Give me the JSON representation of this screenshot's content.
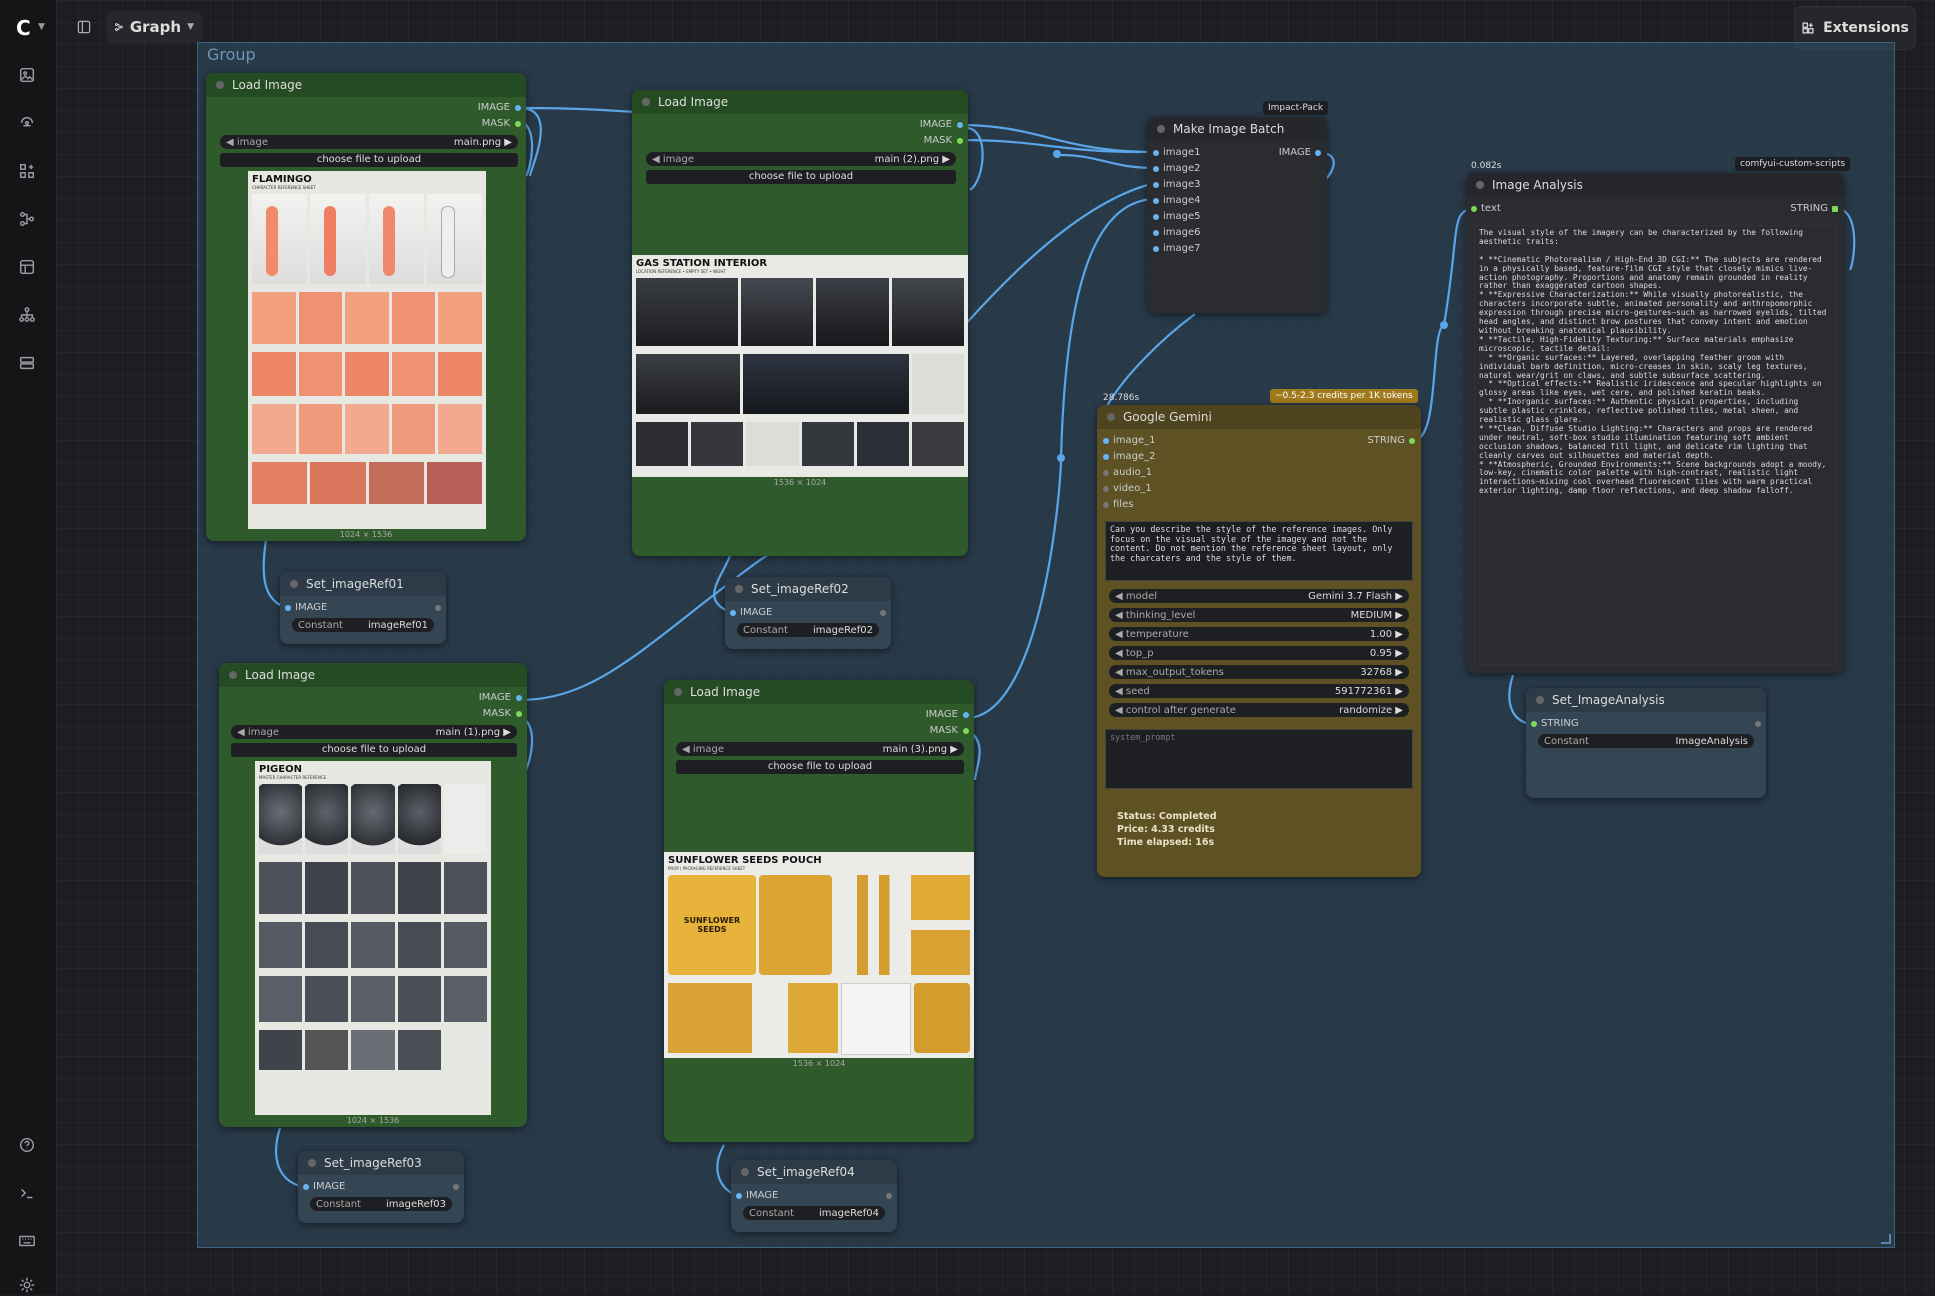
{
  "topbar": {
    "graph_label": "Graph",
    "extensions_label": "Extensions"
  },
  "group": {
    "title": "Group"
  },
  "load_image_nodes": [
    {
      "title": "Load Image",
      "out1": "IMAGE",
      "out2": "MASK",
      "widget_label": "image",
      "widget_value": "main.png",
      "upload_label": "choose file to upload",
      "img_title": "FLAMINGO",
      "img_subtitle": "CHARACTER REFERENCE SHEET",
      "caption": "1024 × 1536"
    },
    {
      "title": "Load Image",
      "out1": "IMAGE",
      "out2": "MASK",
      "widget_label": "image",
      "widget_value": "main (2).png",
      "upload_label": "choose file to upload",
      "img_title": "GAS STATION INTERIOR",
      "img_subtitle": "LOCATION REFERENCE • EMPTY SET • NIGHT",
      "caption": "1536 × 1024"
    },
    {
      "title": "Load Image",
      "out1": "IMAGE",
      "out2": "MASK",
      "widget_label": "image",
      "widget_value": "main (1).png",
      "upload_label": "choose file to upload",
      "img_title": "PIGEON",
      "img_subtitle": "MASTER CHARACTER REFERENCE",
      "caption": "1024 × 1536"
    },
    {
      "title": "Load Image",
      "out1": "IMAGE",
      "out2": "MASK",
      "widget_label": "image",
      "widget_value": "main (3).png",
      "upload_label": "choose file to upload",
      "img_title": "SUNFLOWER SEEDS POUCH",
      "img_subtitle": "PROP | PACKAGING REFERENCE SHEET",
      "caption": "1536 × 1024",
      "pouch_text": "SUNFLOWER SEEDS"
    }
  ],
  "set_nodes": [
    {
      "title": "Set_imageRef01",
      "input": "IMAGE",
      "const_label": "Constant",
      "const_value": "imageRef01"
    },
    {
      "title": "Set_imageRef02",
      "input": "IMAGE",
      "const_label": "Constant",
      "const_value": "imageRef02"
    },
    {
      "title": "Set_imageRef03",
      "input": "IMAGE",
      "const_label": "Constant",
      "const_value": "imageRef03"
    },
    {
      "title": "Set_imageRef04",
      "input": "IMAGE",
      "const_label": "Constant",
      "const_value": "imageRef04"
    },
    {
      "title": "Set_ImageAnalysis",
      "input": "STRING",
      "const_label": "Constant",
      "const_value": "ImageAnalysis"
    }
  ],
  "batch": {
    "badge": "Impact-Pack",
    "title": "Make Image Batch",
    "output": "IMAGE",
    "inputs": [
      "image1",
      "image2",
      "image3",
      "image4",
      "image5",
      "image6",
      "image7"
    ]
  },
  "gemini": {
    "time": "28.786s",
    "credits_badge": "~0.5-2.3 credits per 1K tokens",
    "title": "Google Gemini",
    "output": "STRING",
    "inputs": [
      "image_1",
      "image_2",
      "audio_1",
      "video_1",
      "files"
    ],
    "prompt": "Can you describe the style of the reference images. Only focus on the visual style of the imagey and not the content. Do not mention the reference sheet layout, only the charcaters and the style of them.",
    "widgets": [
      {
        "label": "model",
        "value": "Gemini 3.7 Flash"
      },
      {
        "label": "thinking_level",
        "value": "MEDIUM"
      },
      {
        "label": "temperature",
        "value": "1.00"
      },
      {
        "label": "top_p",
        "value": "0.95"
      },
      {
        "label": "max_output_tokens",
        "value": "32768"
      },
      {
        "label": "seed",
        "value": "591772361"
      },
      {
        "label": "control after generate",
        "value": "randomize"
      }
    ],
    "system_placeholder": "system_prompt",
    "status": "Status: Completed",
    "price": "Price: 4.33 credits",
    "elapsed": "Time elapsed: 16s"
  },
  "analysis": {
    "time": "0.082s",
    "badge": "comfyui-custom-scripts",
    "title": "Image Analysis",
    "input": "text",
    "output": "STRING",
    "text": "The visual style of the imagery can be characterized by the following aesthetic traits:\n\n* **Cinematic Photorealism / High-End 3D CGI:** The subjects are rendered in a physically based, feature-film CGI style that closely mimics live-action photography. Proportions and anatomy remain grounded in reality rather than exaggerated cartoon shapes.\n* **Expressive Characterization:** While visually photorealistic, the characters incorporate subtle, animated personality and anthropomorphic expression through precise micro-gestures—such as narrowed eyelids, tilted head angles, and distinct brow postures that convey intent and emotion without breaking anatomical plausibility.\n* **Tactile, High-Fidelity Texturing:** Surface materials emphasize microscopic, tactile detail:\n  * **Organic surfaces:** Layered, overlapping feather groom with individual barb definition, micro-creases in skin, scaly leg textures, natural wear/grit on claws, and subtle subsurface scattering.\n  * **Optical effects:** Realistic iridescence and specular highlights on glossy areas like eyes, wet cere, and polished keratin beaks.\n  * **Inorganic surfaces:** Authentic physical properties, including subtle plastic crinkles, reflective polished tiles, metal sheen, and realistic glass glare.\n* **Clean, Diffuse Studio Lighting:** Characters and props are rendered under neutral, soft-box studio illumination featuring soft ambient occlusion shadows, balanced fill light, and delicate rim lighting that cleanly carves out silhouettes and material depth.\n* **Atmospheric, Grounded Environments:** Scene backgrounds adopt a moody, low-key, cinematic color palette with high-contrast, realistic light interactions—mixing cool overhead fluorescent tiles with warm practical exterior lighting, damp floor reflections, and deep shadow falloff."
  }
}
